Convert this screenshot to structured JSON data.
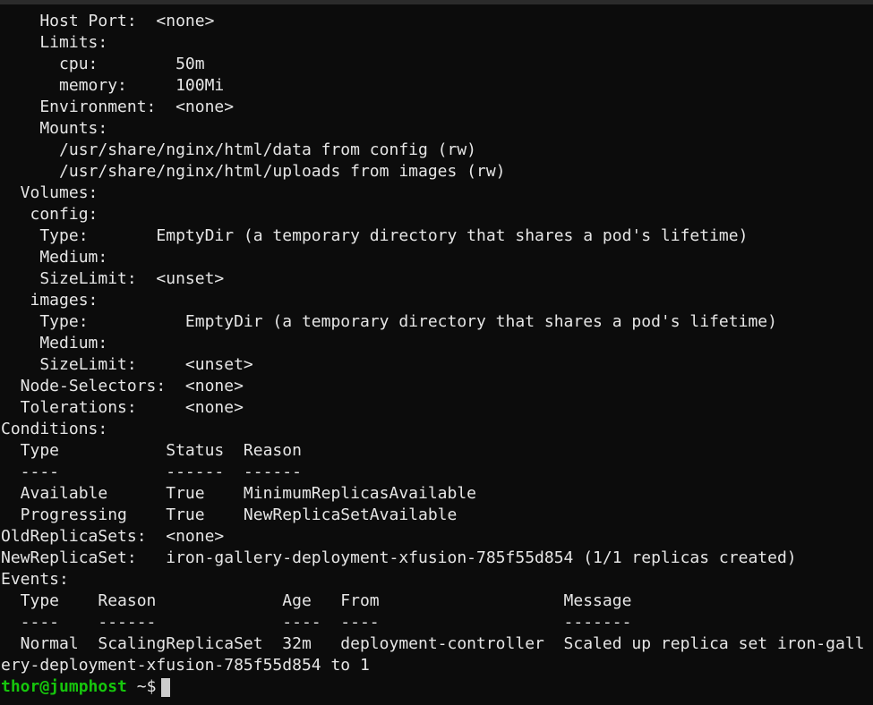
{
  "terminal": {
    "lines": [
      "    Host Port:  <none>",
      "    Limits:",
      "      cpu:        50m",
      "      memory:     100Mi",
      "    Environment:  <none>",
      "    Mounts:",
      "      /usr/share/nginx/html/data from config (rw)",
      "      /usr/share/nginx/html/uploads from images (rw)",
      "  Volumes:",
      "   config:",
      "    Type:       EmptyDir (a temporary directory that shares a pod's lifetime)",
      "    Medium:",
      "    SizeLimit:  <unset>",
      "   images:",
      "    Type:          EmptyDir (a temporary directory that shares a pod's lifetime)",
      "    Medium:",
      "    SizeLimit:     <unset>",
      "  Node-Selectors:  <none>",
      "  Tolerations:     <none>",
      "Conditions:",
      "  Type           Status  Reason",
      "  ----           ------  ------",
      "  Available      True    MinimumReplicasAvailable",
      "  Progressing    True    NewReplicaSetAvailable",
      "OldReplicaSets:  <none>",
      "NewReplicaSet:   iron-gallery-deployment-xfusion-785f55d854 (1/1 replicas created)",
      "Events:",
      "  Type    Reason             Age   From                   Message",
      "  ----    ------             ----  ----                   -------",
      "  Normal  ScalingReplicaSet  32m   deployment-controller  Scaled up replica set iron-gall",
      "ery-deployment-xfusion-785f55d854 to 1"
    ],
    "prompt": {
      "user_host": "thor@jumphost",
      "path_symbol": " ~$"
    }
  }
}
